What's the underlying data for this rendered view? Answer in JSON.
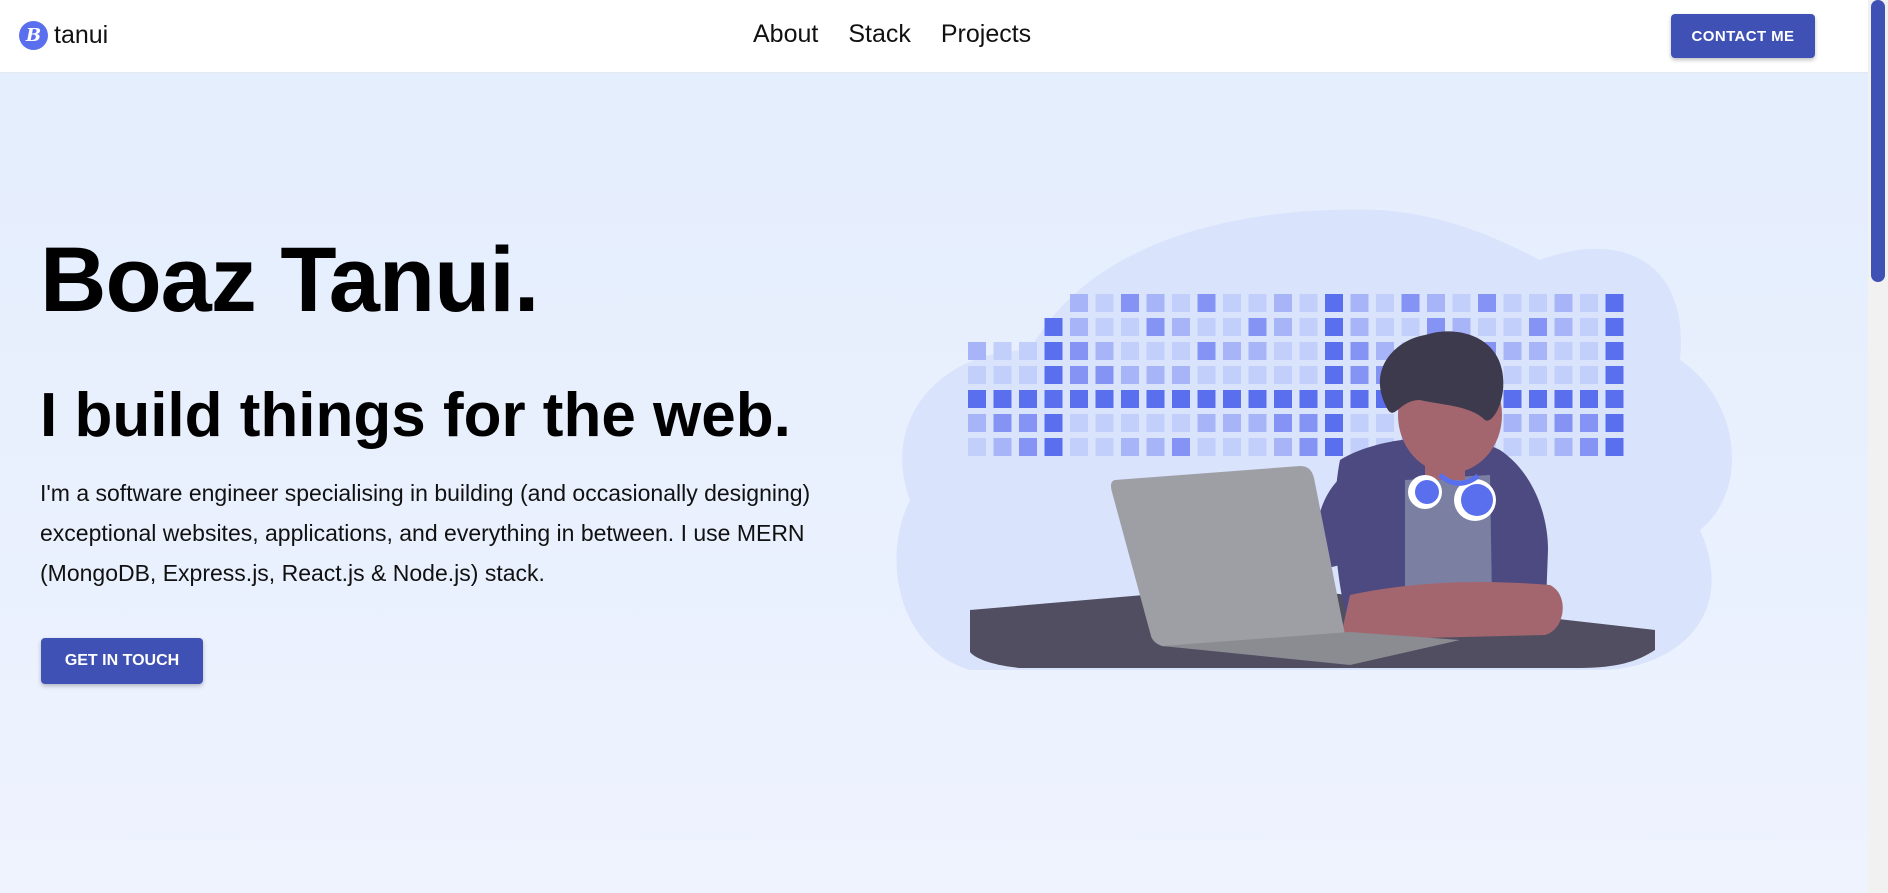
{
  "nav": {
    "brand_logo_letter": "B",
    "brand_name": "tanui",
    "links": [
      {
        "label": "About"
      },
      {
        "label": "Stack"
      },
      {
        "label": "Projects"
      }
    ],
    "contact_label": "CONTACT ME"
  },
  "hero": {
    "title": "Boaz Tanui.",
    "subtitle": "I build things for the web.",
    "description": "I'm a software engineer specialising in building (and occasionally designing) exceptional websites, applications, and everything in between. I use MERN (MongoDB, Express.js, React.js & Node.js) stack.",
    "cta_label": "GET IN TOUCH"
  },
  "colors": {
    "accent": "#3f51b5",
    "logo": "#5a6fee",
    "background": "#e3edfd"
  },
  "illustration": {
    "name": "developer-working-on-laptop-illustration"
  }
}
